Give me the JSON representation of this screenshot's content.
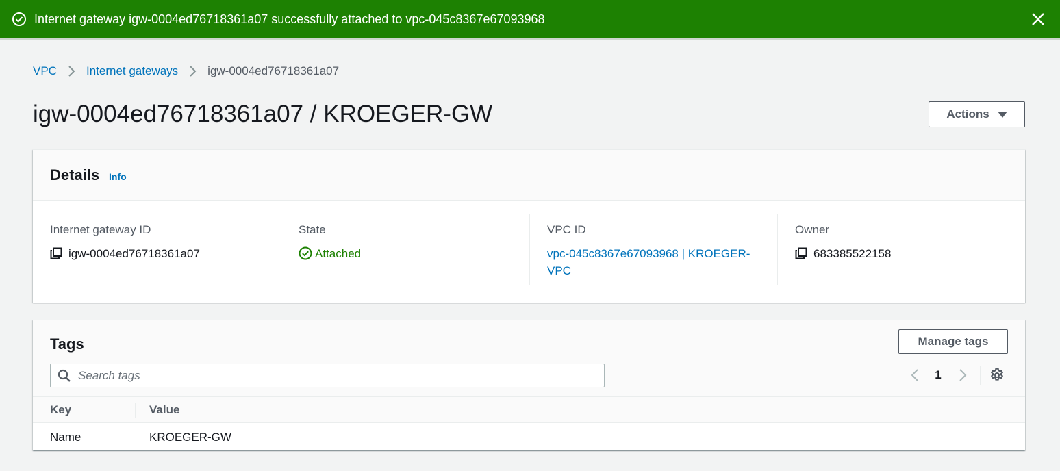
{
  "flash": {
    "message": "Internet gateway igw-0004ed76718361a07 successfully attached to vpc-045c8367e67093968",
    "type": "success",
    "color": "#1d8102"
  },
  "breadcrumb": {
    "items": [
      {
        "label": "VPC"
      },
      {
        "label": "Internet gateways"
      },
      {
        "label": "igw-0004ed76718361a07"
      }
    ]
  },
  "page": {
    "title": "igw-0004ed76718361a07 / KROEGER-GW",
    "actions_label": "Actions"
  },
  "details": {
    "title": "Details",
    "info_label": "Info",
    "fields": {
      "gateway_id": {
        "label": "Internet gateway ID",
        "value": "igw-0004ed76718361a07"
      },
      "state": {
        "label": "State",
        "value": "Attached",
        "status_color": "#1d8102"
      },
      "vpc_id": {
        "label": "VPC ID",
        "value": "vpc-045c8367e67093968 | KROEGER-VPC"
      },
      "owner": {
        "label": "Owner",
        "value": "683385522158"
      }
    }
  },
  "tags": {
    "title": "Tags",
    "manage_label": "Manage tags",
    "search_placeholder": "Search tags",
    "current_page": "1",
    "columns": [
      "Key",
      "Value"
    ],
    "rows": [
      {
        "key": "Name",
        "value": "KROEGER-GW"
      }
    ]
  },
  "colors": {
    "link": "#0073bb",
    "success": "#1d8102",
    "page_bg": "#f2f3f3"
  }
}
